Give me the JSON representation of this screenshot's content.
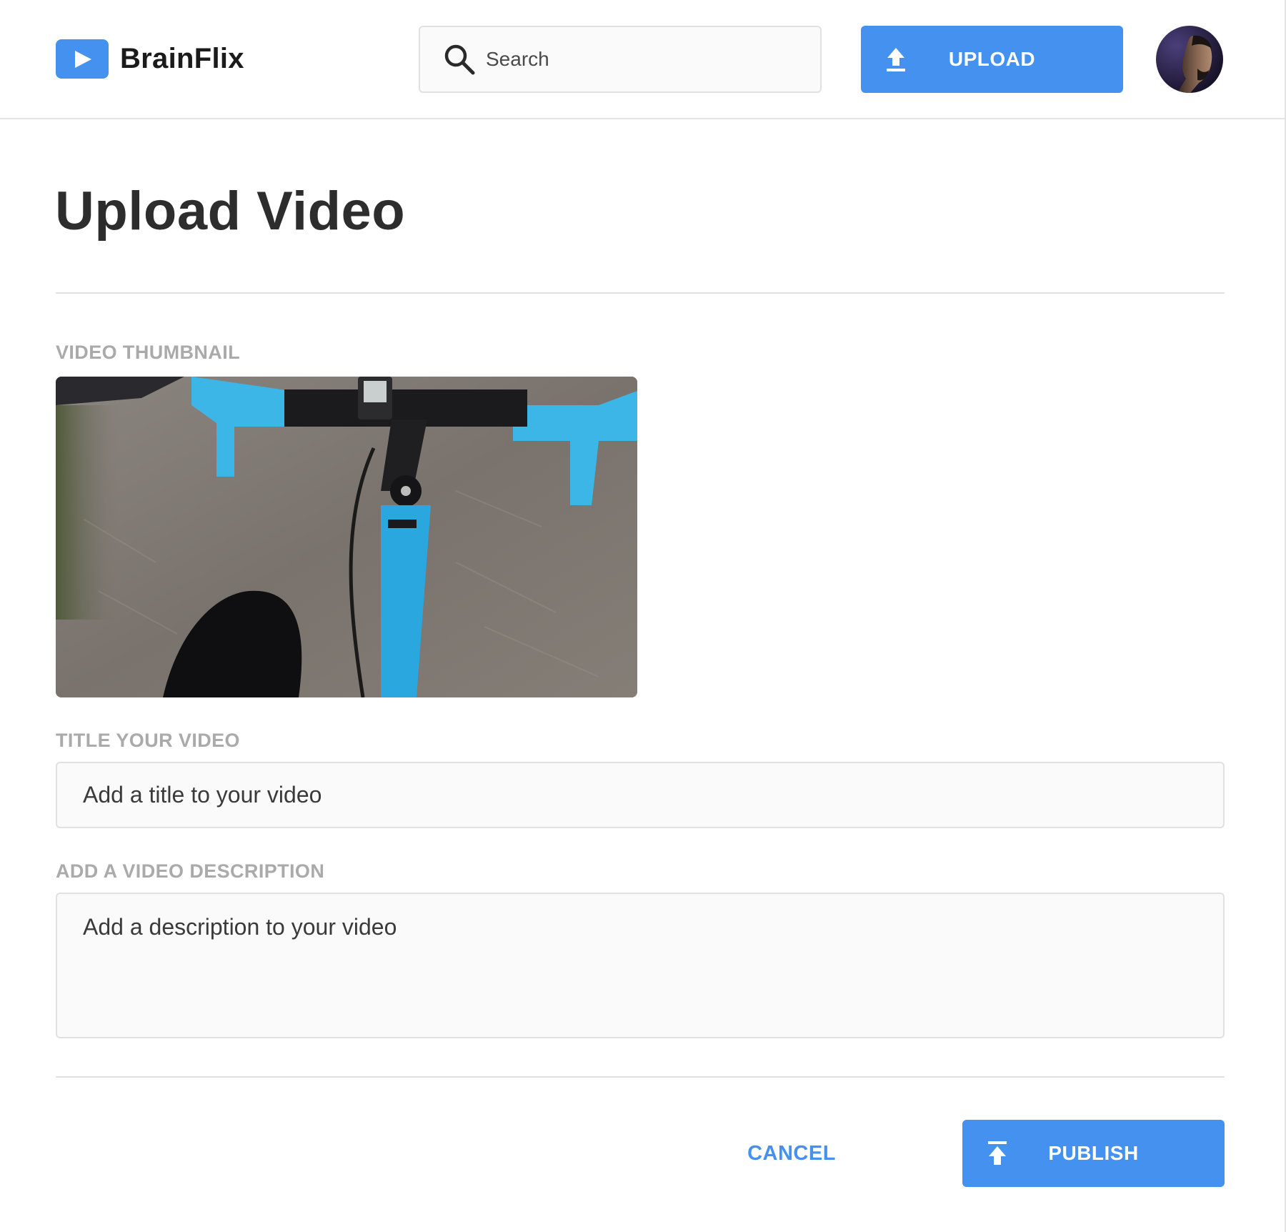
{
  "header": {
    "brand": "BrainFlix",
    "search_placeholder": "Search",
    "upload_label": "UPLOAD"
  },
  "main": {
    "title": "Upload Video",
    "thumbnail_label": "VIDEO THUMBNAIL",
    "title_label": "TITLE YOUR VIDEO",
    "title_placeholder": "Add a title to your video",
    "description_label": "ADD A VIDEO DESCRIPTION",
    "description_placeholder": "Add a description to your video"
  },
  "actions": {
    "cancel_label": "CANCEL",
    "publish_label": "PUBLISH"
  },
  "colors": {
    "accent": "#4491f0",
    "label_gray": "#aaaaaa",
    "field_bg": "#fafafa",
    "border": "#e1e1e1"
  },
  "icons": {
    "logo": "play-icon",
    "search": "search-icon",
    "upload": "upload-icon",
    "publish": "publish-icon"
  }
}
